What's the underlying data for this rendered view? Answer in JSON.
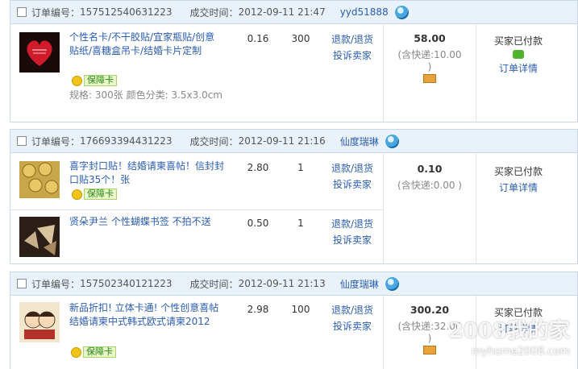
{
  "labels": {
    "order_no": "订单编号：",
    "deal_time": "成交时间：",
    "refund": "退款/退货",
    "complain": "投诉卖家",
    "badge": "保障卡",
    "spec_prefix": "规格: "
  },
  "orders": [
    {
      "order_no": "157512540631223",
      "time": "2012-09-11 21:47",
      "seller": "yyd51888",
      "total": "58.00",
      "shipping": "(含快递:10.00 )",
      "status": "买家已付款",
      "detail": "订单详情",
      "items": [
        {
          "title": "个性名卡/不干胶贴/宜家瓶贴/创意贴纸/喜糖盒吊卡/结婚卡片定制",
          "price": "0.16",
          "qty": "300",
          "spec": "规格: 300张 颜色分类: 3.5x3.0cm"
        }
      ]
    },
    {
      "order_no": "176693394431223",
      "time": "2012-09-11 21:16",
      "seller": "仙度瑞琳",
      "total": "0.10",
      "shipping": "(含快递:0.00 )",
      "status": "买家已付款",
      "detail": "订单详情",
      "items": [
        {
          "title": "喜字封口贴！结婚请柬喜帖！信封封口贴35个！张",
          "price": "2.80",
          "qty": "1"
        },
        {
          "title": "贤朵尹兰 个性蝴蝶书签 不拍不送",
          "price": "0.50",
          "qty": "1"
        }
      ]
    },
    {
      "order_no": "157502340121223",
      "time": "2012-09-11 21:13",
      "seller": "仙度瑞琳",
      "total": "300.20",
      "shipping": "(含快递:32.00 )",
      "status": "买家已付款",
      "detail": "订单详情",
      "items": [
        {
          "title": "新品折扣! 立体卡通! 个性创意喜帖结婚请柬中式韩式欧式请柬2012",
          "price": "2.98",
          "qty": "100"
        }
      ]
    }
  ],
  "watermark": {
    "main": "2008我的家",
    "sub": "myhome2008.com"
  },
  "icons": {
    "badge": "shield-badge-icon",
    "seller_chat": "wangwang-chat-icon",
    "card": "credit-card-icon",
    "message": "message-icon"
  }
}
